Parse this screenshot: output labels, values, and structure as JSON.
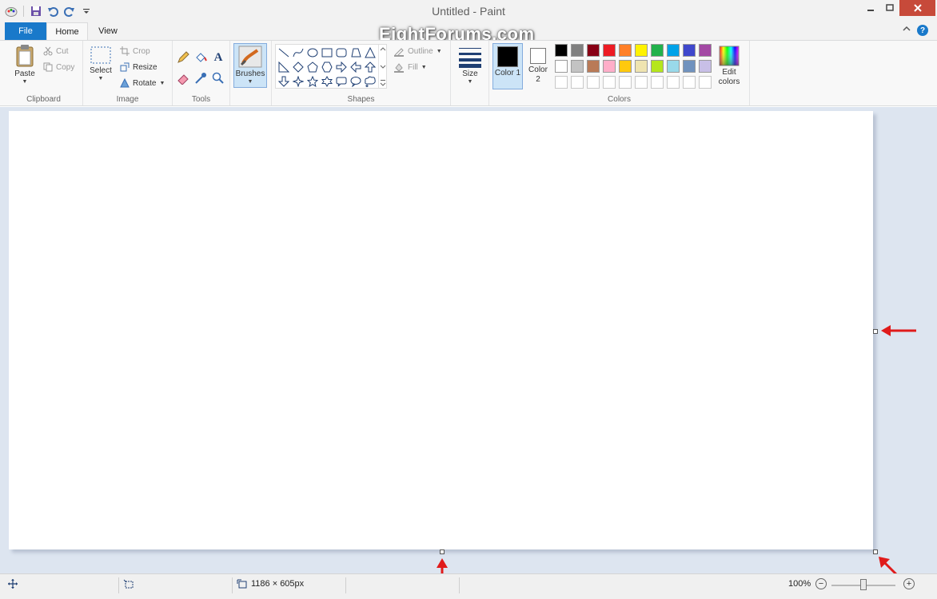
{
  "window": {
    "title": "Untitled - Paint",
    "watermark": "EightForums.com",
    "close_color": "#c74a3a"
  },
  "tabs": {
    "file": "File",
    "home": "Home",
    "view": "View",
    "file_color": "#1979ca"
  },
  "help_glyph": "?",
  "ribbon": {
    "clipboard": {
      "label": "Clipboard",
      "paste": "Paste",
      "cut": "Cut",
      "copy": "Copy"
    },
    "image": {
      "label": "Image",
      "select": "Select",
      "crop": "Crop",
      "resize": "Resize",
      "rotate": "Rotate"
    },
    "tools": {
      "label": "Tools",
      "items": [
        "pencil-icon",
        "fill-bucket-icon",
        "text-icon",
        "eraser-icon",
        "color-picker-icon",
        "magnifier-icon"
      ]
    },
    "brushes": {
      "label": "Brushes"
    },
    "shapes": {
      "label": "Shapes",
      "outline": "Outline",
      "fill": "Fill"
    },
    "size": {
      "label": "Size"
    },
    "colors": {
      "label": "Colors",
      "color1": "Color 1",
      "color2": "Color 2",
      "color1_value": "#000000",
      "color2_value": "#ffffff",
      "edit": "Edit colors",
      "palette_row1": [
        "#000000",
        "#7f7f7f",
        "#880015",
        "#ed1c24",
        "#ff7f27",
        "#fff200",
        "#22b14c",
        "#00a2e8",
        "#3f48cc",
        "#a349a4"
      ],
      "palette_row2": [
        "#ffffff",
        "#c3c3c3",
        "#b97a57",
        "#ffaec9",
        "#ffc90e",
        "#efe4b0",
        "#b5e61d",
        "#99d9ea",
        "#7092be",
        "#c8bfe7"
      ]
    }
  },
  "status": {
    "canvas_size": "1186 × 605px",
    "zoom": "100%",
    "zoom_out": "−",
    "zoom_in": "+"
  }
}
